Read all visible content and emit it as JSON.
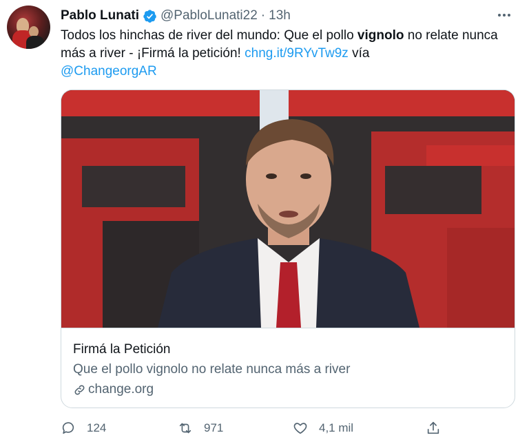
{
  "tweet": {
    "author_name": "Pablo Lunati",
    "handle": "@PabloLunati22",
    "separator": "·",
    "time": "13h",
    "text": {
      "part1": "Todos los hinchas de river del mundo: Que el pollo ",
      "bold": "vignolo",
      "part2": " no relate nunca más a river - ¡Firmá la petición! ",
      "link": "chng.it/9RYvTw9z",
      "part3": " vía ",
      "mention": "@ChangeorgAR"
    }
  },
  "card": {
    "title": "Firmá la Petición",
    "description": "Que el pollo vignolo no relate nunca más a river",
    "domain": "change.org"
  },
  "actions": {
    "replies": "124",
    "retweets": "971",
    "likes": "4,1 mil"
  },
  "icons": [
    "verified-badge-icon",
    "more-icon",
    "link-icon",
    "reply-icon",
    "retweet-icon",
    "like-icon",
    "share-icon"
  ],
  "colors": {
    "accent": "#1d9bf0",
    "text": "#0f1419",
    "secondary": "#536471",
    "border": "#cfd9de",
    "set_red": "#c8302e"
  }
}
